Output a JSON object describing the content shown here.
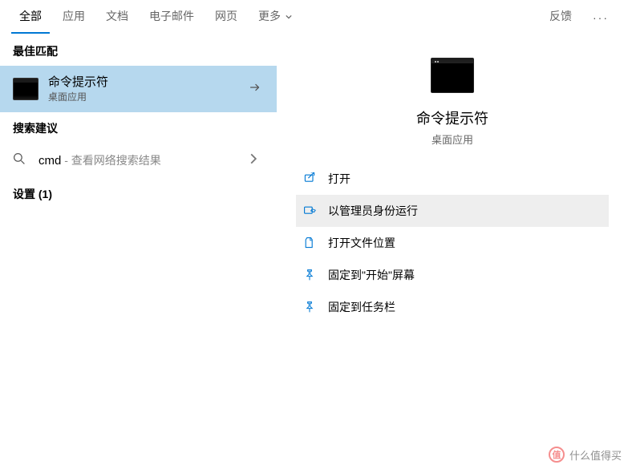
{
  "tabs": {
    "all": "全部",
    "apps": "应用",
    "docs": "文档",
    "email": "电子邮件",
    "web": "网页",
    "more": "更多",
    "feedback": "反馈"
  },
  "left": {
    "best_match_header": "最佳匹配",
    "result": {
      "title": "命令提示符",
      "subtitle": "桌面应用"
    },
    "suggestions_header": "搜索建议",
    "suggest": {
      "main": "cmd",
      "suffix": " - 查看网络搜索结果"
    },
    "settings_header": "设置 (1)"
  },
  "detail": {
    "title": "命令提示符",
    "subtitle": "桌面应用"
  },
  "actions": {
    "open": "打开",
    "run_as_admin": "以管理员身份运行",
    "open_file_location": "打开文件位置",
    "pin_start": "固定到\"开始\"屏幕",
    "pin_taskbar": "固定到任务栏"
  },
  "watermark": "什么值得买"
}
